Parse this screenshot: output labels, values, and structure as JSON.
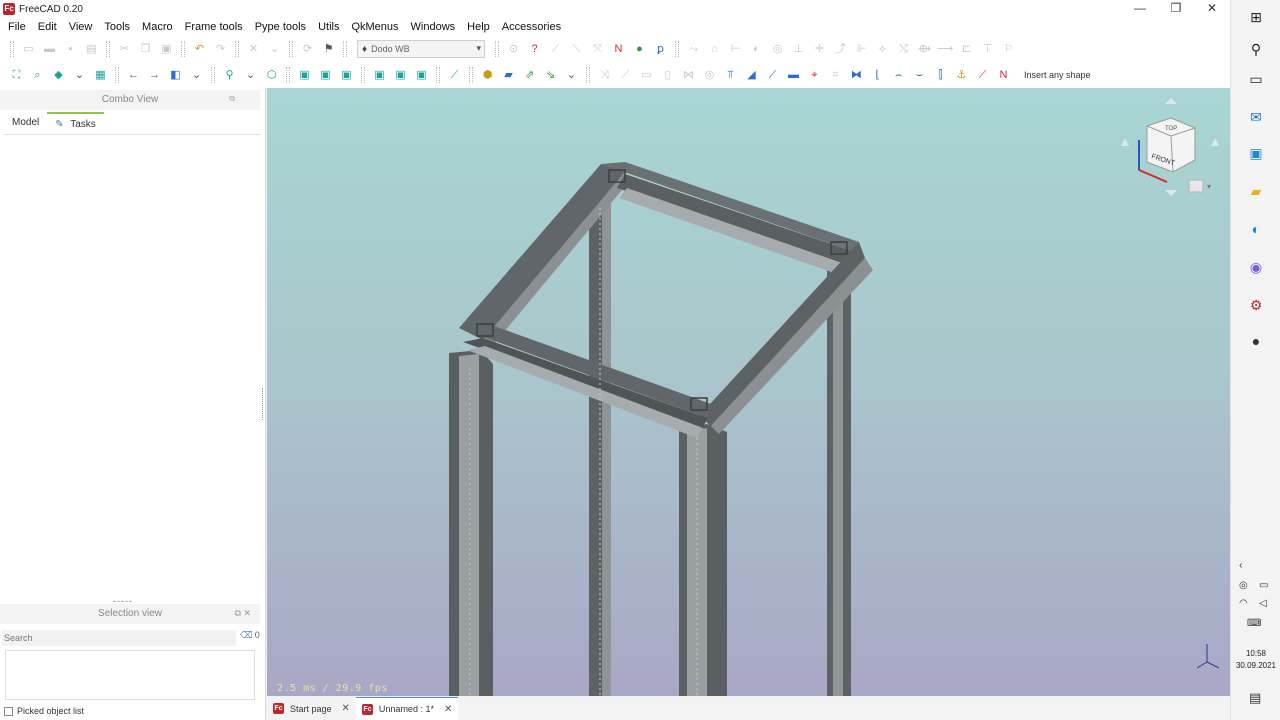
{
  "window": {
    "title": "FreeCAD 0.20",
    "app_icon": "Fc"
  },
  "window_controls": {
    "minimize": "—",
    "restore": "❐",
    "close": "✕"
  },
  "menu": [
    "File",
    "Edit",
    "View",
    "Tools",
    "Macro",
    "Frame tools",
    "Pype tools",
    "Utils",
    "QkMenus",
    "Windows",
    "Help",
    "Accessories"
  ],
  "toolbar": {
    "workbench_selected": "Dodo WB",
    "insert_label": "Insert any shape"
  },
  "combo_view": {
    "title": "Combo View",
    "tabs": {
      "model": "Model",
      "tasks": "Tasks"
    }
  },
  "splitter_mark": "-----",
  "selection_view": {
    "title": "Selection view",
    "search_placeholder": "Search",
    "count": "0",
    "picked_label": "Picked object list"
  },
  "viewport": {
    "fps_text": "2.5 ms / 29.9 fps",
    "navcube_face_top": "TOP",
    "navcube_face_front": "FRONT"
  },
  "document_tabs": [
    {
      "label": "Start page"
    },
    {
      "label": "Unnamed : 1*"
    }
  ],
  "taskbar": {
    "time": "10:58",
    "date": "30.09.2021"
  },
  "colors": {
    "viewport_top": "#a8d6d2",
    "viewport_bottom": "#a9a7c6",
    "frame_dark": "#5a5f62",
    "frame_light": "#8e9496",
    "fps_text": "#e8e39a",
    "active_tab_accent": "#8ec63f"
  }
}
